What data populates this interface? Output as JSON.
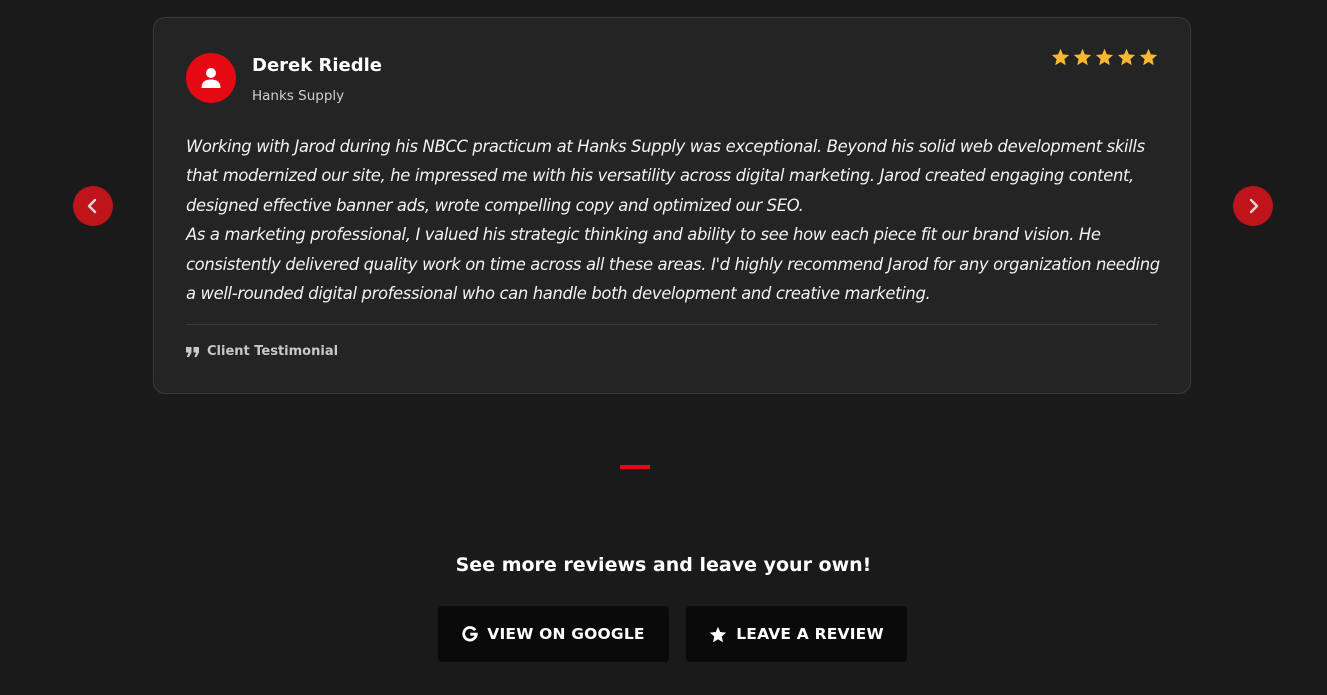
{
  "testimonial": {
    "name": "Derek Riedle",
    "company": "Hanks Supply",
    "rating": 5,
    "rating_max": 5,
    "paragraphs": [
      "Working with Jarod during his NBCC practicum at Hanks Supply was exceptional. Beyond his solid web development skills that modernized our site, he impressed me with his versatility across digital marketing. Jarod created engaging content, designed effective banner ads, wrote compelling copy and optimized our SEO.",
      "As a marketing professional, I valued his strategic thinking and ability to see how each piece fit our brand vision. He consistently delivered quality work on time across all these areas. I'd highly recommend Jarod for any organization needing a well-rounded digital professional who can handle both development and creative marketing."
    ],
    "footer_label": "Client Testimonial",
    "footer_icon": "quote-icon",
    "avatar_icon": "user-icon"
  },
  "carousel": {
    "prev_icon": "chevron-left-icon",
    "next_icon": "chevron-right-icon"
  },
  "cta": {
    "heading": "See more reviews and leave your own!",
    "google_label": "VIEW ON GOOGLE",
    "google_icon": "google-icon",
    "review_label": "LEAVE A REVIEW",
    "review_icon": "star-icon"
  },
  "colors": {
    "background": "#1a1a1a",
    "card": "#242424",
    "accent": "#e50914",
    "star": "#f7b733",
    "button": "#0a0a0a"
  }
}
